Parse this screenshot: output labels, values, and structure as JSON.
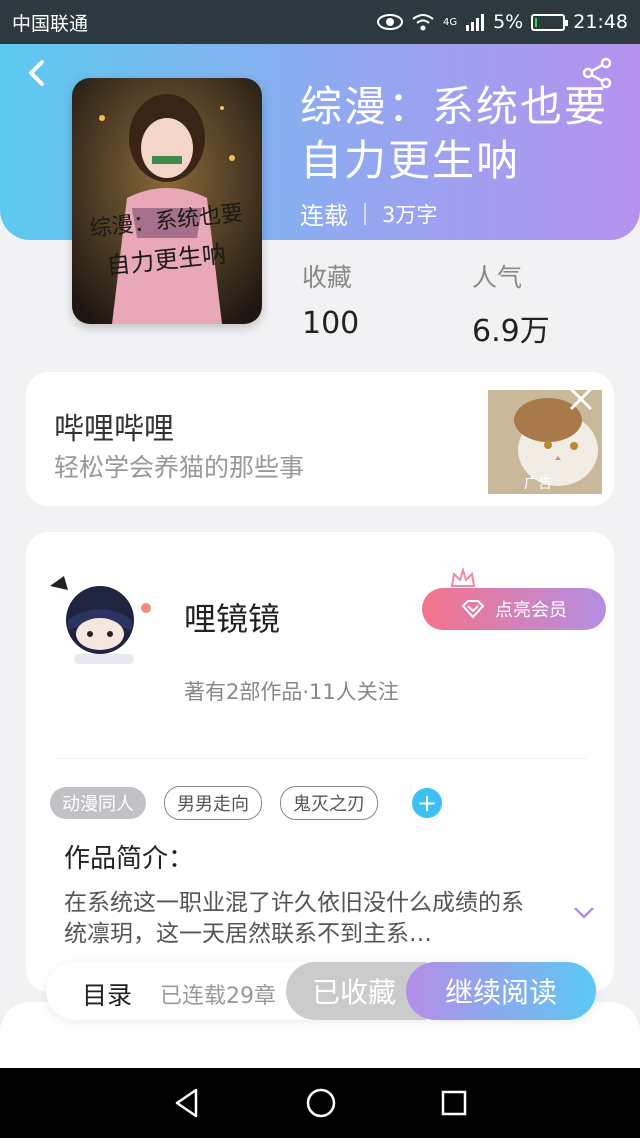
{
  "status_bar": {
    "carrier": "中国联通",
    "battery_percent": "5%",
    "time": "21:48",
    "network": "4G"
  },
  "book": {
    "title": "综漫：系统也要自力更生呐",
    "status": "连载",
    "word_count": "3万字",
    "stats": [
      {
        "label": "收藏",
        "value": "100"
      },
      {
        "label": "人气",
        "value": "6.9万"
      }
    ],
    "cover_text": "综漫：系统也要自力更生呐"
  },
  "ad": {
    "title": "哔哩哔哩",
    "subtitle": "轻松学会养猫的那些事",
    "badge": "广告"
  },
  "author": {
    "name": "哩镜镜",
    "info": "著有2部作品·11人关注",
    "vip_button": "点亮会员"
  },
  "tags": [
    "动漫同人",
    "男男走向",
    "鬼灭之刃"
  ],
  "intro": {
    "title": "作品简介：",
    "text": "在系统这一职业混了许久依旧没什么成绩的系统凛玥，这一天居然联系不到主系…"
  },
  "bottom_bar": {
    "toc_label": "目录",
    "toc_status": "已连载29章",
    "collected_label": "已收藏",
    "continue_label": "继续阅读"
  },
  "colors": {
    "header_start": "#5ccaf0",
    "header_end": "#b592ee",
    "accent_blue": "#3cbff2"
  }
}
